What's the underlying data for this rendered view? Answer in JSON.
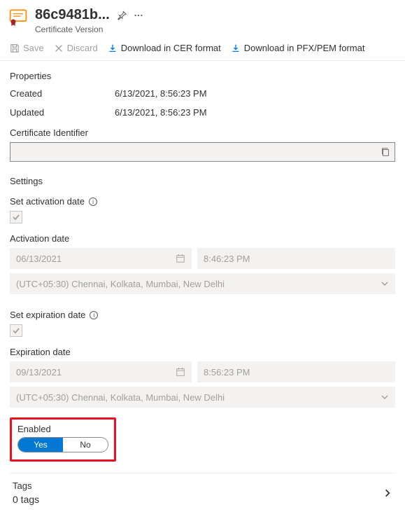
{
  "header": {
    "title": "86c9481b...",
    "subtitle": "Certificate Version"
  },
  "toolbar": {
    "save": "Save",
    "discard": "Discard",
    "download_cer": "Download in CER format",
    "download_pfx": "Download in PFX/PEM format"
  },
  "properties": {
    "heading": "Properties",
    "created_label": "Created",
    "created_value": "6/13/2021, 8:56:23 PM",
    "updated_label": "Updated",
    "updated_value": "6/13/2021, 8:56:23 PM",
    "identifier_label": "Certificate Identifier",
    "identifier_value": ""
  },
  "settings": {
    "heading": "Settings",
    "activation_label": "Set activation date",
    "activation_date_label": "Activation date",
    "activation_date": "06/13/2021",
    "activation_time": "8:46:23 PM",
    "activation_tz": "(UTC+05:30) Chennai, Kolkata, Mumbai, New Delhi",
    "expiration_label": "Set expiration date",
    "expiration_date_label": "Expiration date",
    "expiration_date": "09/13/2021",
    "expiration_time": "8:56:23 PM",
    "expiration_tz": "(UTC+05:30) Chennai, Kolkata, Mumbai, New Delhi",
    "enabled_label": "Enabled",
    "enabled_yes": "Yes",
    "enabled_no": "No"
  },
  "tags": {
    "label": "Tags",
    "count": "0 tags"
  }
}
